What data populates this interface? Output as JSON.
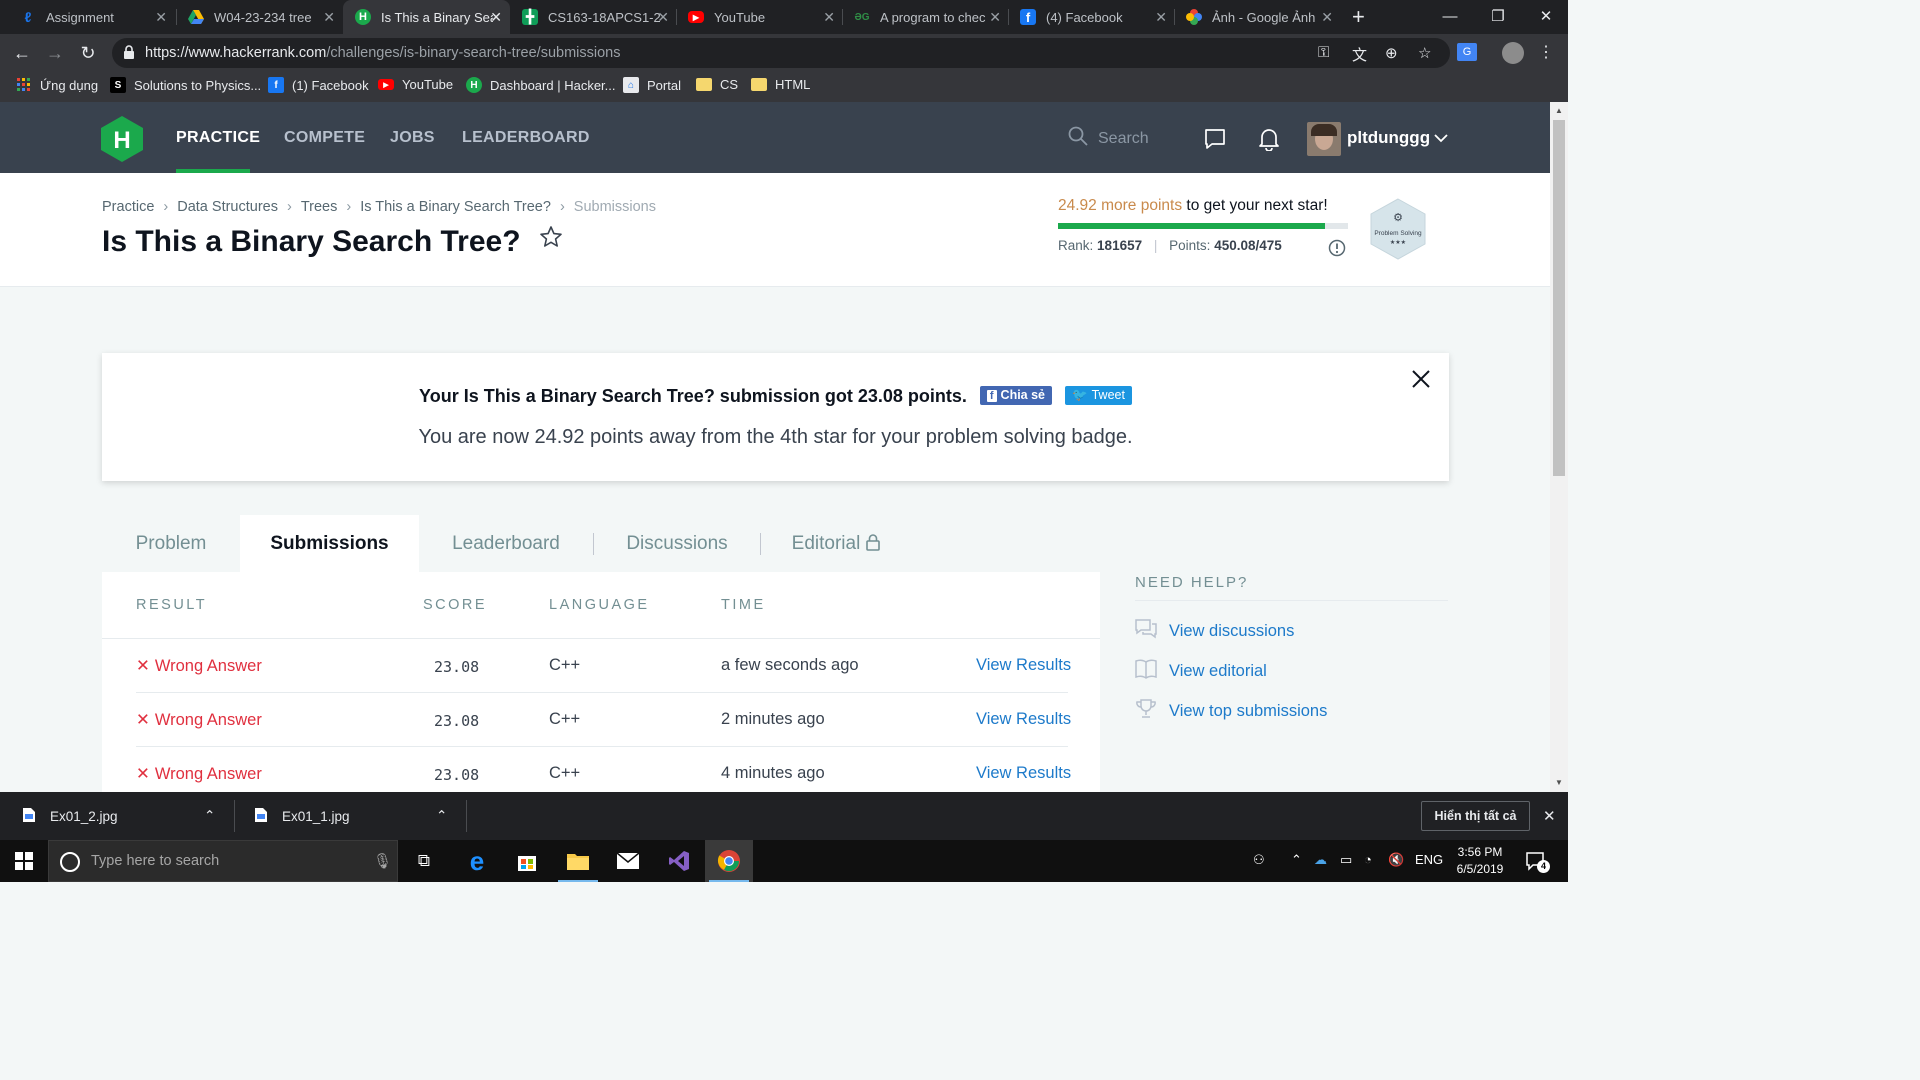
{
  "browser": {
    "tabs": [
      {
        "label": "Assignment",
        "icon": "moodle-icon",
        "color": "#1a73e8"
      },
      {
        "label": "W04-23-234 tree",
        "icon": "google-drive-icon",
        "color": "#1fa463"
      },
      {
        "label": "Is This a Binary Sea",
        "icon": "hackerrank-icon",
        "color": "#1ba94c",
        "active": true
      },
      {
        "label": "CS163-18APCS1-2",
        "icon": "google-sheets-icon",
        "color": "#0f9d58"
      },
      {
        "label": "YouTube",
        "icon": "youtube-icon",
        "color": "#ff0000"
      },
      {
        "label": "A program to chec",
        "icon": "geeksforgeeks-icon",
        "color": "#2f8d46"
      },
      {
        "label": "(4) Facebook",
        "icon": "facebook-icon",
        "color": "#1877f2"
      },
      {
        "label": "Ảnh - Google Ảnh",
        "icon": "google-photos-icon",
        "color": "#fbbc04"
      }
    ],
    "new_tab": "+",
    "url_main": "https://www.hackerrank.com",
    "url_path": "/challenges/is-binary-search-tree/submissions",
    "bookmarks": [
      {
        "label": "Ứng dụng",
        "icon": "apps-grid-icon"
      },
      {
        "label": "Solutions to Physics...",
        "icon": "slader-icon"
      },
      {
        "label": "(1) Facebook",
        "icon": "facebook-icon"
      },
      {
        "label": "YouTube",
        "icon": "youtube-icon"
      },
      {
        "label": "Dashboard | Hacker...",
        "icon": "hackerrank-icon"
      },
      {
        "label": "Portal",
        "icon": "portal-icon"
      },
      {
        "label": "CS",
        "icon": "folder-icon"
      },
      {
        "label": "HTML",
        "icon": "folder-icon"
      }
    ]
  },
  "nav": {
    "links": [
      "PRACTICE",
      "COMPETE",
      "JOBS",
      "LEADERBOARD"
    ],
    "search_placeholder": "Search",
    "username": "pltdunggg"
  },
  "breadcrumb": [
    "Practice",
    "Data Structures",
    "Trees",
    "Is This a Binary Search Tree?",
    "Submissions"
  ],
  "title": "Is This a Binary Search Tree?",
  "progress": {
    "points_needed": "24.92 more points",
    "suffix": " to get your next star!",
    "fraction": 0.92,
    "rank_label": "Rank:",
    "rank": "181657",
    "points_label": "Points:",
    "points": "450.08/475",
    "badge_label": "Problem Solving",
    "badge_stars": "★★★"
  },
  "notice": {
    "line1": "Your Is This a Binary Search Tree? submission got 23.08 points.",
    "share_label": "Chia sẻ",
    "tweet_label": "Tweet",
    "line2": "You are now 24.92 points away from the 4th star for your problem solving badge."
  },
  "challenge_tabs": [
    "Problem",
    "Submissions",
    "Leaderboard",
    "Discussions",
    "Editorial"
  ],
  "submissions": {
    "headers": [
      "RESULT",
      "SCORE",
      "LANGUAGE",
      "TIME"
    ],
    "rows": [
      {
        "result": "Wrong Answer",
        "score": "23.08",
        "language": "C++",
        "time": "a few seconds ago",
        "action": "View Results"
      },
      {
        "result": "Wrong Answer",
        "score": "23.08",
        "language": "C++",
        "time": "2 minutes ago",
        "action": "View Results"
      },
      {
        "result": "Wrong Answer",
        "score": "23.08",
        "language": "C++",
        "time": "4 minutes ago",
        "action": "View Results"
      }
    ]
  },
  "help": {
    "title": "NEED HELP?",
    "items": [
      "View discussions",
      "View editorial",
      "View top submissions"
    ]
  },
  "downloads": {
    "items": [
      "Ex01_2.jpg",
      "Ex01_1.jpg"
    ],
    "show_all": "Hiển thị tất cả"
  },
  "taskbar": {
    "search_placeholder": "Type here to search",
    "lang": "ENG",
    "time": "3:56 PM",
    "date": "6/5/2019",
    "notification_count": "4"
  },
  "colors": {
    "hr_nav": "#39424e",
    "hr_green": "#1ba94c",
    "wrong": "#e0303f",
    "link": "#1d7aca"
  }
}
